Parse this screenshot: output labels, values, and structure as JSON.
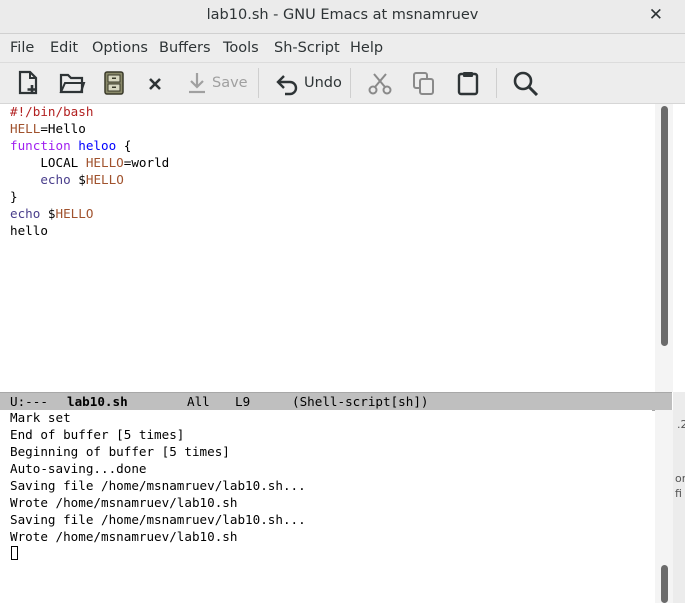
{
  "window": {
    "title": "lab10.sh - GNU Emacs at msnamruev",
    "close_glyph": "✕"
  },
  "menubar": {
    "items": [
      "File",
      "Edit",
      "Options",
      "Buffers",
      "Tools",
      "Sh-Script",
      "Help"
    ]
  },
  "toolbar": {
    "save_label": "Save",
    "undo_label": "Undo",
    "icons": [
      "new-file-icon",
      "open-folder-icon",
      "dired-cabinet-icon",
      "close-buffer-icon",
      "save-icon",
      "undo-icon",
      "cut-icon",
      "copy-icon",
      "paste-icon",
      "search-icon"
    ]
  },
  "buffer": {
    "lines": [
      [
        {
          "t": "#!/bin/bash",
          "c": "comment"
        }
      ],
      [
        {
          "t": "HELL",
          "c": "varname"
        },
        {
          "t": "=Hello",
          "c": ""
        }
      ],
      [
        {
          "t": "function",
          "c": "kw"
        },
        {
          "t": " ",
          "c": ""
        },
        {
          "t": "heloo",
          "c": "fn"
        },
        {
          "t": " {",
          "c": ""
        }
      ],
      [
        {
          "t": "    LOCAL ",
          "c": ""
        },
        {
          "t": "HELLO",
          "c": "varname"
        },
        {
          "t": "=world",
          "c": ""
        }
      ],
      [
        {
          "t": "    ",
          "c": ""
        },
        {
          "t": "echo",
          "c": "builtin"
        },
        {
          "t": " $",
          "c": ""
        },
        {
          "t": "HELLO",
          "c": "varname"
        }
      ],
      [
        {
          "t": "}",
          "c": ""
        }
      ],
      [
        {
          "t": "echo",
          "c": "builtin"
        },
        {
          "t": " $",
          "c": ""
        },
        {
          "t": "HELLO",
          "c": "varname"
        }
      ],
      [
        {
          "t": "hello",
          "c": ""
        }
      ]
    ]
  },
  "modeline": {
    "status": "U:---",
    "buffer_name": "lab10.sh",
    "position": "All",
    "line": "L9",
    "mode": "(Shell-script[sh])"
  },
  "messages": [
    "Mark set",
    "End of buffer [5 times]",
    "Beginning of buffer [5 times]",
    "Auto-saving...done",
    "Saving file /home/msnamruev/lab10.sh...",
    "Wrote /home/msnamruev/lab10.sh",
    "Saving file /home/msnamruev/lab10.sh...",
    "Wrote /home/msnamruev/lab10.sh"
  ],
  "background_window_fragments": [
    ".2",
    "om",
    "fi"
  ]
}
